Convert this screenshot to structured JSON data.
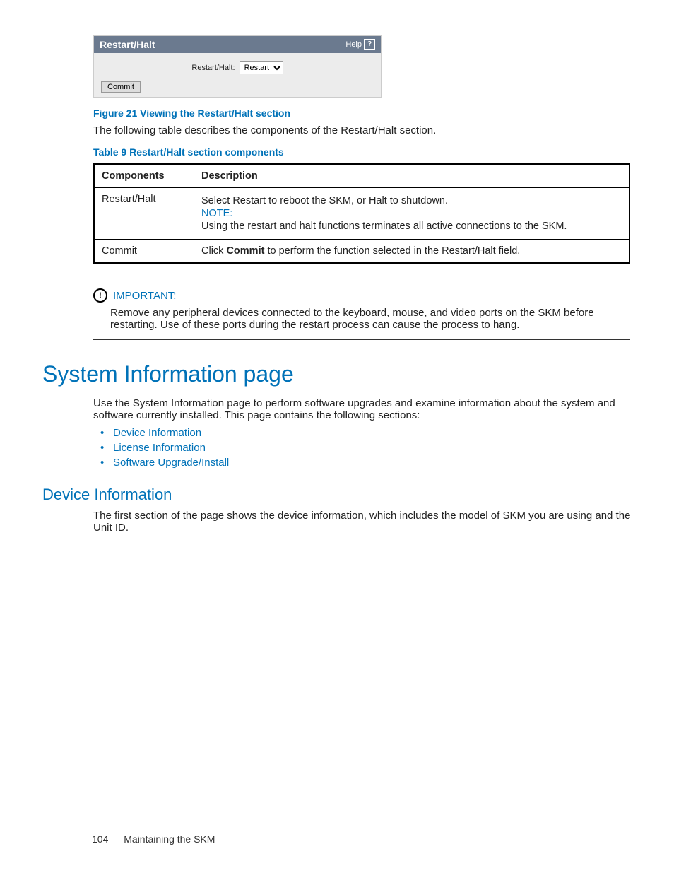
{
  "panel": {
    "title": "Restart/Halt",
    "help_label": "Help",
    "field_label": "Restart/Halt:",
    "select_value": "Restart",
    "commit_label": "Commit"
  },
  "fig_caption": "Figure 21 Viewing the Restart/Halt section",
  "intro_text": "The following table describes the components of the Restart/Halt section.",
  "tbl_caption": "Table 9 Restart/Halt section components",
  "table": {
    "head_col1": "Components",
    "head_col2": "Description",
    "row1": {
      "c1": "Restart/Halt",
      "desc1": "Select Restart to reboot the SKM, or Halt to shutdown.",
      "note_label": "NOTE:",
      "desc2": "Using the restart and halt functions terminates all active connections to the SKM."
    },
    "row2": {
      "c1": "Commit",
      "desc_pre": "Click ",
      "desc_strong": "Commit",
      "desc_post": " to perform the function selected in the Restart/Halt field."
    }
  },
  "important": {
    "label": "IMPORTANT:",
    "body": "Remove any peripheral devices connected to the keyboard, mouse, and video ports on the SKM before restarting. Use of these ports during the restart process can cause the process to hang."
  },
  "h1": "System Information page",
  "h1_body": "Use the System Information page to perform software upgrades and examine information about the system and software currently installed. This page contains the following sections:",
  "bullets": {
    "b1": "Device Information",
    "b2": "License Information",
    "b3": "Software Upgrade/Install"
  },
  "h2": "Device Information",
  "h2_body": "The first section of the page shows the device information, which includes the model of SKM you are using and the Unit ID.",
  "footer": {
    "page_num": "104",
    "title": "Maintaining the SKM"
  }
}
